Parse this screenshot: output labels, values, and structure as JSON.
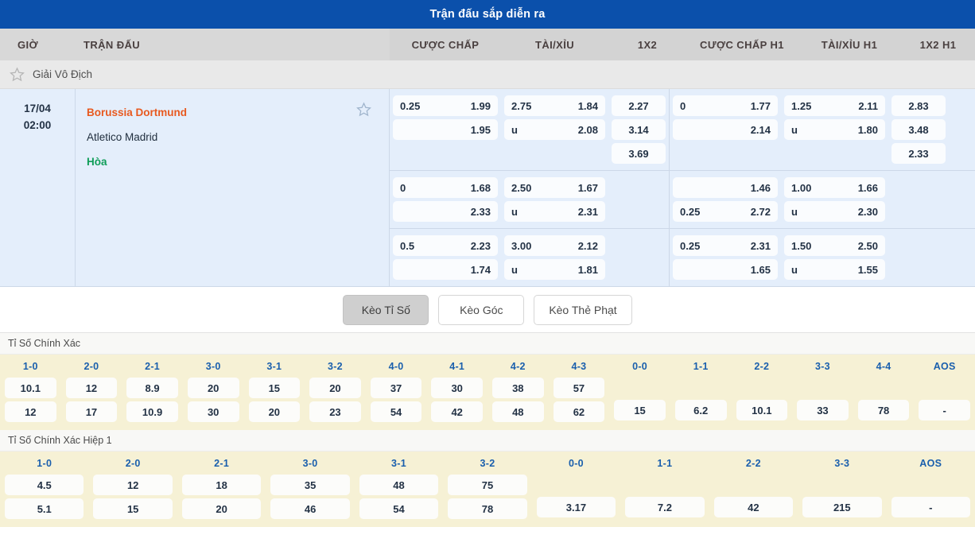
{
  "header": {
    "title": "Trận đấu sắp diễn ra"
  },
  "columns": {
    "time": "GIỜ",
    "match": "TRẬN ĐẤU",
    "odds": [
      "CƯỢC CHẤP",
      "TÀI/XỈU",
      "1X2",
      "CƯỢC CHẤP H1",
      "TÀI/XỈU H1",
      "1X2 H1"
    ]
  },
  "league": {
    "name": "Giải Vô Địch",
    "star_icon": "star-outline-icon"
  },
  "match": {
    "date": "17/04",
    "time": "02:00",
    "home": "Borussia Dortmund",
    "away": "Atletico Madrid",
    "draw": "Hòa",
    "fav_icon": "star-outline-icon"
  },
  "odds_blocks": [
    {
      "handicap": [
        {
          "l": "0.25",
          "r": "1.99"
        },
        {
          "l": "",
          "r": "1.95"
        }
      ],
      "overunder": [
        {
          "l": "2.75",
          "r": "1.84"
        },
        {
          "l": "u",
          "r": "2.08"
        }
      ],
      "x12": [
        "2.27",
        "3.14",
        "3.69"
      ],
      "handicap_h1": [
        {
          "l": "0",
          "r": "1.77"
        },
        {
          "l": "",
          "r": "2.14"
        }
      ],
      "overunder_h1": [
        {
          "l": "1.25",
          "r": "2.11"
        },
        {
          "l": "u",
          "r": "1.80"
        }
      ],
      "x12_h1": [
        "2.83",
        "3.48",
        "2.33"
      ]
    },
    {
      "handicap": [
        {
          "l": "0",
          "r": "1.68"
        },
        {
          "l": "",
          "r": "2.33"
        }
      ],
      "overunder": [
        {
          "l": "2.50",
          "r": "1.67"
        },
        {
          "l": "u",
          "r": "2.31"
        }
      ],
      "x12": [],
      "handicap_h1": [
        {
          "l": "",
          "r": "1.46"
        },
        {
          "l": "0.25",
          "r": "2.72"
        }
      ],
      "overunder_h1": [
        {
          "l": "1.00",
          "r": "1.66"
        },
        {
          "l": "u",
          "r": "2.30"
        }
      ],
      "x12_h1": []
    },
    {
      "handicap": [
        {
          "l": "0.5",
          "r": "2.23"
        },
        {
          "l": "",
          "r": "1.74"
        }
      ],
      "overunder": [
        {
          "l": "3.00",
          "r": "2.12"
        },
        {
          "l": "u",
          "r": "1.81"
        }
      ],
      "x12": [],
      "handicap_h1": [
        {
          "l": "0.25",
          "r": "2.31"
        },
        {
          "l": "",
          "r": "1.65"
        }
      ],
      "overunder_h1": [
        {
          "l": "1.50",
          "r": "2.50"
        },
        {
          "l": "u",
          "r": "1.55"
        }
      ],
      "x12_h1": []
    }
  ],
  "tabs": [
    {
      "label": "Kèo Tỉ Số",
      "active": true
    },
    {
      "label": "Kèo Góc",
      "active": false
    },
    {
      "label": "Kèo Thẻ Phạt",
      "active": false
    }
  ],
  "correct_score": {
    "title": "Tỉ Số Chính Xác",
    "columns": [
      {
        "label": "1-0",
        "values": [
          "10.1",
          "12"
        ]
      },
      {
        "label": "2-0",
        "values": [
          "12",
          "17"
        ]
      },
      {
        "label": "2-1",
        "values": [
          "8.9",
          "10.9"
        ]
      },
      {
        "label": "3-0",
        "values": [
          "20",
          "30"
        ]
      },
      {
        "label": "3-1",
        "values": [
          "15",
          "20"
        ]
      },
      {
        "label": "3-2",
        "values": [
          "20",
          "23"
        ]
      },
      {
        "label": "4-0",
        "values": [
          "37",
          "54"
        ]
      },
      {
        "label": "4-1",
        "values": [
          "30",
          "42"
        ]
      },
      {
        "label": "4-2",
        "values": [
          "38",
          "48"
        ]
      },
      {
        "label": "4-3",
        "values": [
          "57",
          "62"
        ]
      },
      {
        "label": "0-0",
        "values": [
          "15"
        ]
      },
      {
        "label": "1-1",
        "values": [
          "6.2"
        ]
      },
      {
        "label": "2-2",
        "values": [
          "10.1"
        ]
      },
      {
        "label": "3-3",
        "values": [
          "33"
        ]
      },
      {
        "label": "4-4",
        "values": [
          "78"
        ]
      },
      {
        "label": "AOS",
        "values": [
          "-"
        ]
      }
    ]
  },
  "correct_score_h1": {
    "title": "Tỉ Số Chính Xác Hiệp 1",
    "columns": [
      {
        "label": "1-0",
        "values": [
          "4.5",
          "5.1"
        ]
      },
      {
        "label": "2-0",
        "values": [
          "12",
          "15"
        ]
      },
      {
        "label": "2-1",
        "values": [
          "18",
          "20"
        ]
      },
      {
        "label": "3-0",
        "values": [
          "35",
          "46"
        ]
      },
      {
        "label": "3-1",
        "values": [
          "48",
          "54"
        ]
      },
      {
        "label": "3-2",
        "values": [
          "75",
          "78"
        ]
      },
      {
        "label": "0-0",
        "values": [
          "3.17"
        ]
      },
      {
        "label": "1-1",
        "values": [
          "7.2"
        ]
      },
      {
        "label": "2-2",
        "values": [
          "42"
        ]
      },
      {
        "label": "3-3",
        "values": [
          "215"
        ]
      },
      {
        "label": "AOS",
        "values": [
          "-"
        ]
      }
    ]
  },
  "colors": {
    "title_bar": "#0b50ab",
    "home_team": "#e8591f",
    "draw_team": "#0f9d58",
    "score_header": "#1a5fad",
    "score_bg": "#f6f1d5",
    "match_bg": "#e4eefb"
  }
}
